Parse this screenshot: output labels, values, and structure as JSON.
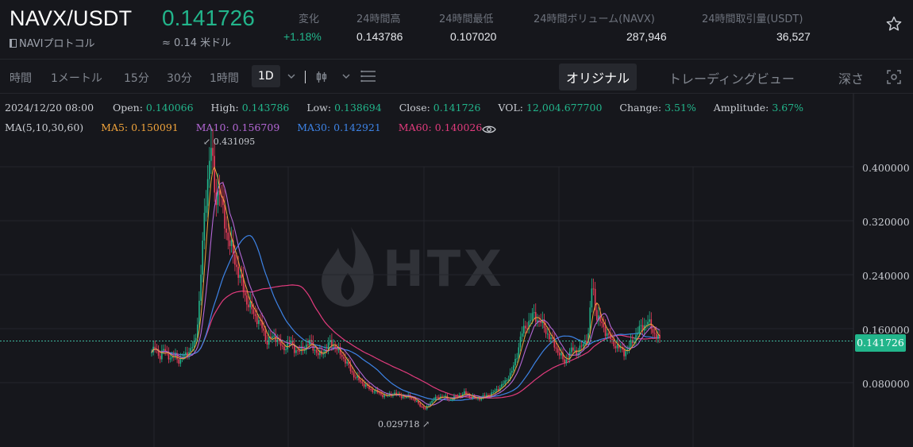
{
  "header": {
    "pair": "NAVX/USDT",
    "protocol": "NAVIプロトコル",
    "price": "0.141726",
    "approx_fiat": "≈ 0.14 米ドル",
    "stats": [
      {
        "label": "変化",
        "value": "+1.18%"
      },
      {
        "label": "24時間高",
        "value": "0.143786"
      },
      {
        "label": "24時間最低",
        "value": "0.107020"
      },
      {
        "label": "24時間ボリューム(NAVX)",
        "value": "287,946"
      },
      {
        "label": "24時間取引量(USDT)",
        "value": "36,527"
      }
    ]
  },
  "toolbar": {
    "intervals": [
      "時間",
      "1メートル",
      "15分",
      "30分",
      "1時間",
      "1D"
    ],
    "selected_interval": "1D",
    "views": [
      "オリジナル",
      "トレーディングビュー",
      "深さ"
    ],
    "selected_view": "オリジナル"
  },
  "ohlc": {
    "date": "2024/12/20 08:00",
    "open_label": "Open:",
    "open": "0.140066",
    "high_label": "High:",
    "high": "0.143786",
    "low_label": "Low:",
    "low": "0.138694",
    "close_label": "Close:",
    "close": "0.141726",
    "vol_label": "VOL:",
    "vol": "12,004.677700",
    "change_label": "Change:",
    "change": "3.51%",
    "amp_label": "Amplitude:",
    "amp": "3.67%"
  },
  "ma": {
    "label": "MA(5,10,30,60)",
    "ma5": "MA5: 0.150091",
    "ma10": "MA10: 0.156709",
    "ma30": "MA30: 0.142921",
    "ma60": "MA60: 0.140026"
  },
  "chart_data": {
    "type": "candlestick",
    "y_ticks": [
      "0.400000",
      "0.320000",
      "0.240000",
      "0.160000",
      "0.080000"
    ],
    "current_price": "0.141726",
    "max_label": "0.431095",
    "min_label": "0.029718",
    "watermark": "HTX",
    "close_series": [
      0.125,
      0.132,
      0.118,
      0.128,
      0.122,
      0.115,
      0.12,
      0.112,
      0.118,
      0.125,
      0.13,
      0.14,
      0.2,
      0.3,
      0.38,
      0.431,
      0.35,
      0.37,
      0.33,
      0.3,
      0.28,
      0.26,
      0.24,
      0.22,
      0.2,
      0.19,
      0.18,
      0.17,
      0.16,
      0.14,
      0.145,
      0.15,
      0.14,
      0.13,
      0.135,
      0.14,
      0.13,
      0.125,
      0.13,
      0.135,
      0.14,
      0.13,
      0.12,
      0.125,
      0.13,
      0.14,
      0.135,
      0.125,
      0.12,
      0.11,
      0.1,
      0.09,
      0.085,
      0.08,
      0.075,
      0.07,
      0.068,
      0.065,
      0.062,
      0.06,
      0.062,
      0.064,
      0.062,
      0.06,
      0.058,
      0.06,
      0.055,
      0.05,
      0.045,
      0.04,
      0.05,
      0.055,
      0.058,
      0.06,
      0.058,
      0.055,
      0.057,
      0.06,
      0.062,
      0.065,
      0.06,
      0.058,
      0.056,
      0.058,
      0.06,
      0.062,
      0.065,
      0.07,
      0.075,
      0.08,
      0.09,
      0.1,
      0.12,
      0.15,
      0.16,
      0.17,
      0.18,
      0.175,
      0.17,
      0.16,
      0.15,
      0.14,
      0.13,
      0.12,
      0.11,
      0.12,
      0.13,
      0.125,
      0.13,
      0.14,
      0.15,
      0.23,
      0.18,
      0.17,
      0.16,
      0.15,
      0.14,
      0.135,
      0.13,
      0.125,
      0.13,
      0.14,
      0.15,
      0.16,
      0.165,
      0.17,
      0.16,
      0.15,
      0.1417
    ]
  }
}
